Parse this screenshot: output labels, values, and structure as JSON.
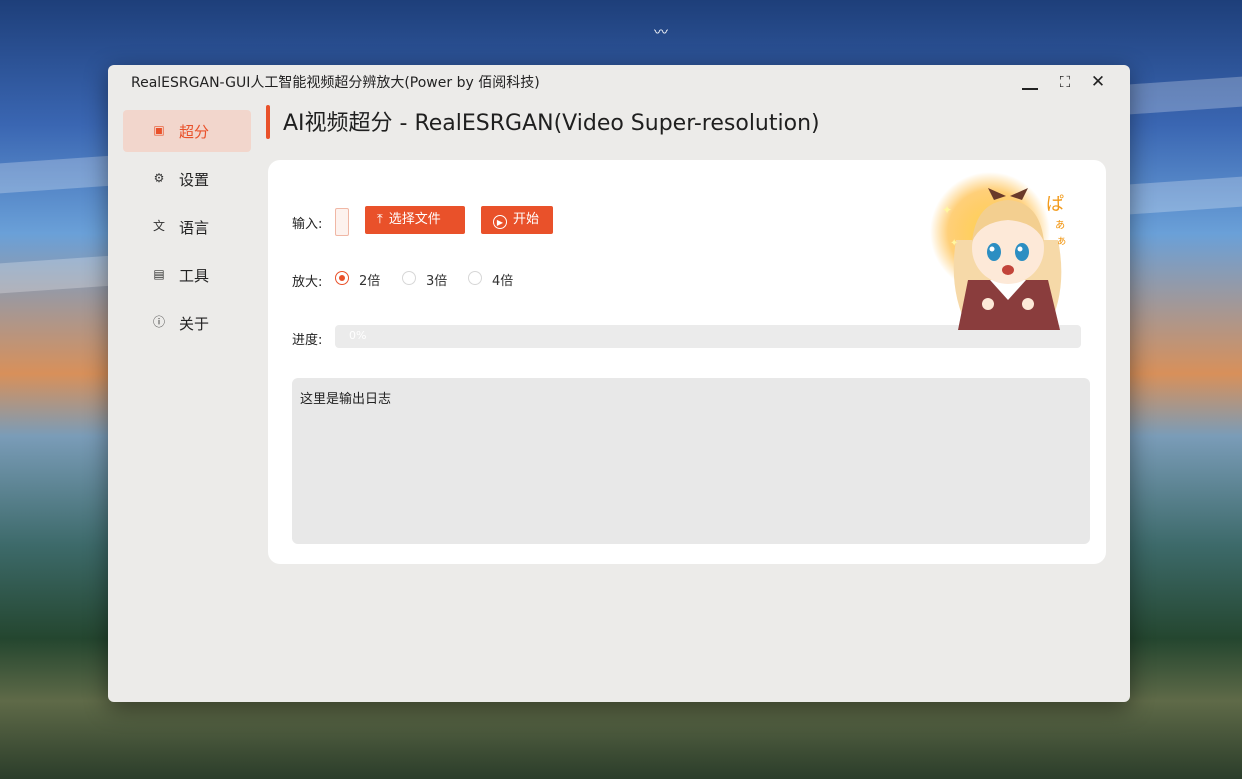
{
  "window": {
    "title": "RealESRGAN-GUI人工智能视频超分辨放大(Power by 佰阅科技)",
    "controls": {
      "minimize": "",
      "maximize": "⛶",
      "close": "✕"
    }
  },
  "sidebar": {
    "items": [
      {
        "label": "超分",
        "icon": "image-icon",
        "glyph": "▣",
        "active": true
      },
      {
        "label": "设置",
        "icon": "gear-icon",
        "glyph": "⚙",
        "active": false
      },
      {
        "label": "语言",
        "icon": "translate-icon",
        "glyph": "文",
        "active": false
      },
      {
        "label": "工具",
        "icon": "toolbox-icon",
        "glyph": "▤",
        "active": false
      },
      {
        "label": "关于",
        "icon": "info-icon",
        "glyph": "ⓘ",
        "active": false
      }
    ]
  },
  "page": {
    "title": "AI视频超分 - RealESRGAN(Video Super-resolution)"
  },
  "form": {
    "input_label": "输入:",
    "select_file_label": "选择文件",
    "start_label": "开始",
    "scale_label": "放大:",
    "scale_options": [
      {
        "label": "2倍",
        "checked": true
      },
      {
        "label": "3倍",
        "checked": false
      },
      {
        "label": "4倍",
        "checked": false
      }
    ],
    "progress_label": "进度:",
    "progress_value": 0,
    "progress_text": "0%",
    "log_text": "这里是输出日志"
  },
  "colors": {
    "accent": "#e9512a",
    "window_bg": "#ecebe9",
    "card_bg": "#ffffff"
  }
}
